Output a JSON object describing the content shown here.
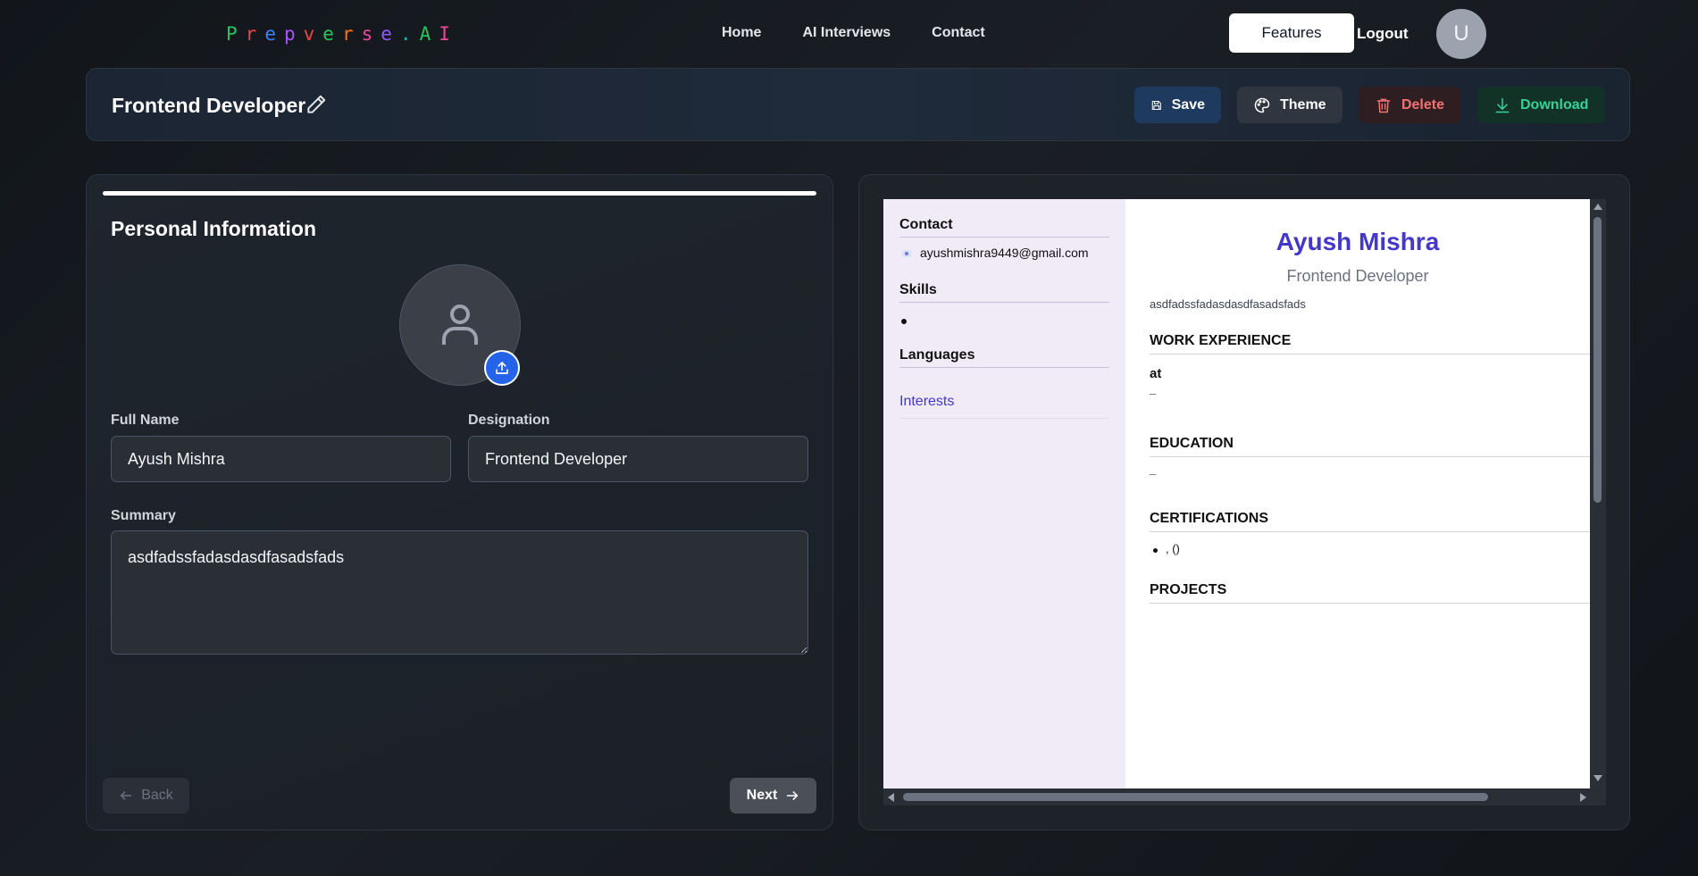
{
  "nav": {
    "logo_letters": [
      "P",
      "r",
      "e",
      "p",
      "v",
      "e",
      "r",
      "s",
      "e",
      ".",
      "A",
      "I"
    ],
    "logo_colors": [
      "#22c55e",
      "#ef4444",
      "#3b82f6",
      "#a855f7",
      "#ef4444",
      "#22c55e",
      "#f97316",
      "#ec4899",
      "#8b5cf6",
      "#06b6d4",
      "#22c55e",
      "#ec4899"
    ],
    "links": [
      "Home",
      "AI Interviews",
      "Contact"
    ],
    "features_label": "Features",
    "logout_label": "Logout",
    "avatar_initial": "U"
  },
  "titlebar": {
    "title": "Frontend Developer",
    "edit_icon": "pencil-icon",
    "save_label": "Save",
    "theme_label": "Theme",
    "delete_label": "Delete",
    "download_label": "Download"
  },
  "form": {
    "progress": 1.0,
    "section_title": "Personal Information",
    "photo_icon": "user-icon",
    "upload_icon": "upload-icon",
    "full_name_label": "Full Name",
    "full_name_value": "Ayush Mishra",
    "designation_label": "Designation",
    "designation_value": "Frontend Developer",
    "summary_label": "Summary",
    "summary_value": "asdfadssfadasdasdfasadsfads",
    "back_label": "Back",
    "next_label": "Next"
  },
  "preview": {
    "sidebar": {
      "contact_title": "Contact",
      "email": "ayushmishra9449@gmail.com",
      "skills_title": "Skills",
      "languages_title": "Languages",
      "interests_title": "Interests"
    },
    "name": "Ayush Mishra",
    "role": "Frontend Developer",
    "summary": "asdfadssfadasdasdfasadsfads",
    "work_title": "WORK EXPERIENCE",
    "work_at": "at",
    "work_dash": "–",
    "education_title": "EDUCATION",
    "education_dash": "–",
    "certifications_title": "CERTIFICATIONS",
    "cert_item": ", ()",
    "projects_title": "PROJECTS"
  },
  "colors": {
    "accent": "#4338ca",
    "save_bg": "#1e3a5f",
    "delete_text": "#f87171",
    "download_text": "#34d399",
    "upload_bg": "#2563eb"
  }
}
